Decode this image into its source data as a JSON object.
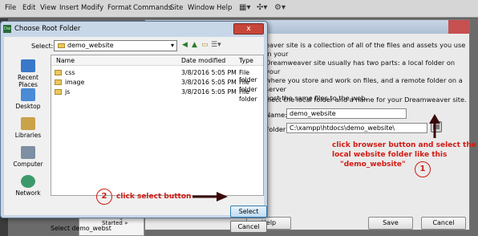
{
  "menubar": {
    "items": [
      "File",
      "Edit",
      "View",
      "Insert",
      "Modify",
      "Format",
      "Commands",
      "Site",
      "Window",
      "Help"
    ]
  },
  "site_setup": {
    "intro_lines": [
      "eaver site is a collection of all of the files and assets you use in your",
      "Dreamweaver site usually has two parts: a local folder on your",
      "where you store and work on files, and a remote folder on a server",
      "post the same files to the web."
    ],
    "instruction": "elect the local folder and a name for your Dreamweaver site.",
    "name_label": "Name:",
    "name_value": "demo_website",
    "folder_label": "Folder:",
    "folder_value": "C:\\xampp\\htdocs\\demo_website\\",
    "help_label": "Help",
    "save_label": "Save",
    "cancel_label": "Cancel"
  },
  "files_panel": {
    "rows": [
      "Getting Started »"
    ]
  },
  "dialog": {
    "title": "Choose Root Folder",
    "close_label": "x",
    "select_label": "Select:",
    "lookin_value": "demo_website",
    "places": [
      "Recent Places",
      "Desktop",
      "Libraries",
      "Computer",
      "Network"
    ],
    "columns": [
      "Name",
      "Date modified",
      "Type"
    ],
    "rows": [
      {
        "name": "css",
        "date": "3/8/2016 5:05 PM",
        "type": "File folder"
      },
      {
        "name": "image",
        "date": "3/8/2016 5:05 PM",
        "type": "File folder"
      },
      {
        "name": "js",
        "date": "3/8/2016 5:05 PM",
        "type": "File folder"
      }
    ],
    "select_status": "Select demo_webst",
    "select_button": "Select",
    "cancel_button": "Cancel"
  },
  "annotations": {
    "step1_number": "1",
    "step1_text_lines": [
      "click browser button and select the",
      "local website folder like this",
      "\"demo_website\""
    ],
    "step2_number": "2",
    "step2_text": "click select button"
  },
  "colors": {
    "annotation": "#d11a12",
    "dialog_frame": "#c8d7e8",
    "folder": "#e8c860"
  }
}
